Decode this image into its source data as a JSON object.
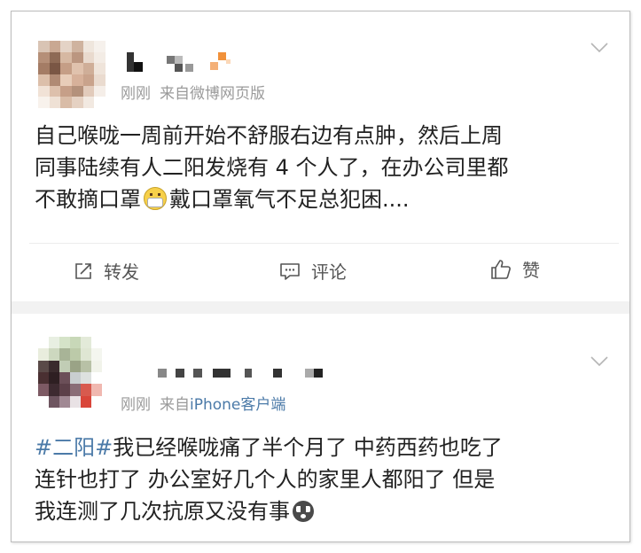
{
  "posts": [
    {
      "time": "刚刚",
      "source": "来自微博网页版",
      "content_lines": [
        "自己喉咙一周前开始不舒服右边有点肿，然后上周",
        "同事陆续有人二阳发烧有 4 个人了，在办公司里都"
      ],
      "line3_before_emoji": "不敢摘口罩",
      "line3_after_emoji": "戴口罩氧气不足总犯困....",
      "emoji": "mask-face-emoji",
      "actions": {
        "repost": "转发",
        "comment": "评论",
        "like": "赞"
      }
    },
    {
      "time": "刚刚",
      "source_prefix": "来自",
      "source_link": "iPhone客户端",
      "hashtag": "#二阳#",
      "line1_rest": "我已经喉咙痛了半个月了 中药西药也吃了",
      "line2": "连针也打了 办公室好几个人的家里人都阳了 但是",
      "line3": "我连测了几次抗原又没有事",
      "emoji": "crying-face-emoji"
    }
  ],
  "colors": {
    "link": "#4b7aa8",
    "meta": "#9a9a9a",
    "text": "#222222",
    "separator": "#f2f2f2"
  }
}
